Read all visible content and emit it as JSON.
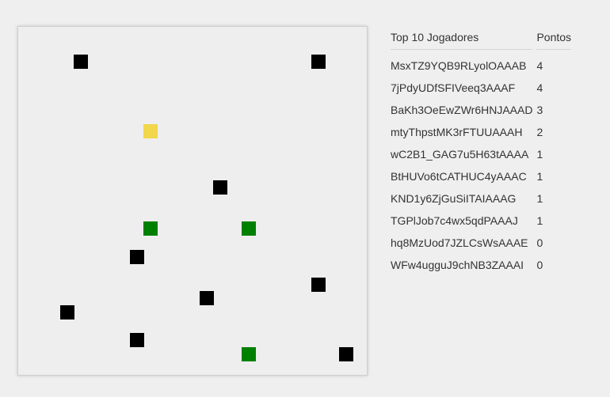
{
  "board": {
    "colors": {
      "player": "#000000",
      "self": "#f2d64b",
      "food": "#008000"
    },
    "cells": [
      {
        "col": 4,
        "row": 2,
        "type": "player"
      },
      {
        "col": 21,
        "row": 2,
        "type": "player"
      },
      {
        "col": 9,
        "row": 7,
        "type": "self"
      },
      {
        "col": 14,
        "row": 11,
        "type": "player"
      },
      {
        "col": 9,
        "row": 14,
        "type": "food"
      },
      {
        "col": 16,
        "row": 14,
        "type": "food"
      },
      {
        "col": 8,
        "row": 16,
        "type": "player"
      },
      {
        "col": 21,
        "row": 18,
        "type": "player"
      },
      {
        "col": 13,
        "row": 19,
        "type": "player"
      },
      {
        "col": 3,
        "row": 20,
        "type": "player"
      },
      {
        "col": 8,
        "row": 22,
        "type": "player"
      },
      {
        "col": 16,
        "row": 23,
        "type": "food"
      },
      {
        "col": 23,
        "row": 23,
        "type": "player"
      }
    ],
    "grid_size": 25
  },
  "scoreboard": {
    "header_name": "Top 10 Jogadores",
    "header_points": "Pontos",
    "rows": [
      {
        "name": "MsxTZ9YQB9RLyolOAAAB",
        "points": "4"
      },
      {
        "name": "7jPdyUDfSFIVeeq3AAAF",
        "points": "4"
      },
      {
        "name": "BaKh3OeEwZWr6HNJAAAD",
        "points": "3"
      },
      {
        "name": "mtyThpstMK3rFTUUAAAH",
        "points": "2"
      },
      {
        "name": "wC2B1_GAG7u5H63tAAAA",
        "points": "1"
      },
      {
        "name": "BtHUVo6tCATHUC4yAAAC",
        "points": "1"
      },
      {
        "name": "KND1y6ZjGuSiITAIAAAG",
        "points": "1"
      },
      {
        "name": "TGPlJob7c4wx5qdPAAAJ",
        "points": "1"
      },
      {
        "name": "hq8MzUod7JZLCsWsAAAE",
        "points": "0"
      },
      {
        "name": "WFw4ugguJ9chNB3ZAAAI",
        "points": "0"
      }
    ]
  }
}
